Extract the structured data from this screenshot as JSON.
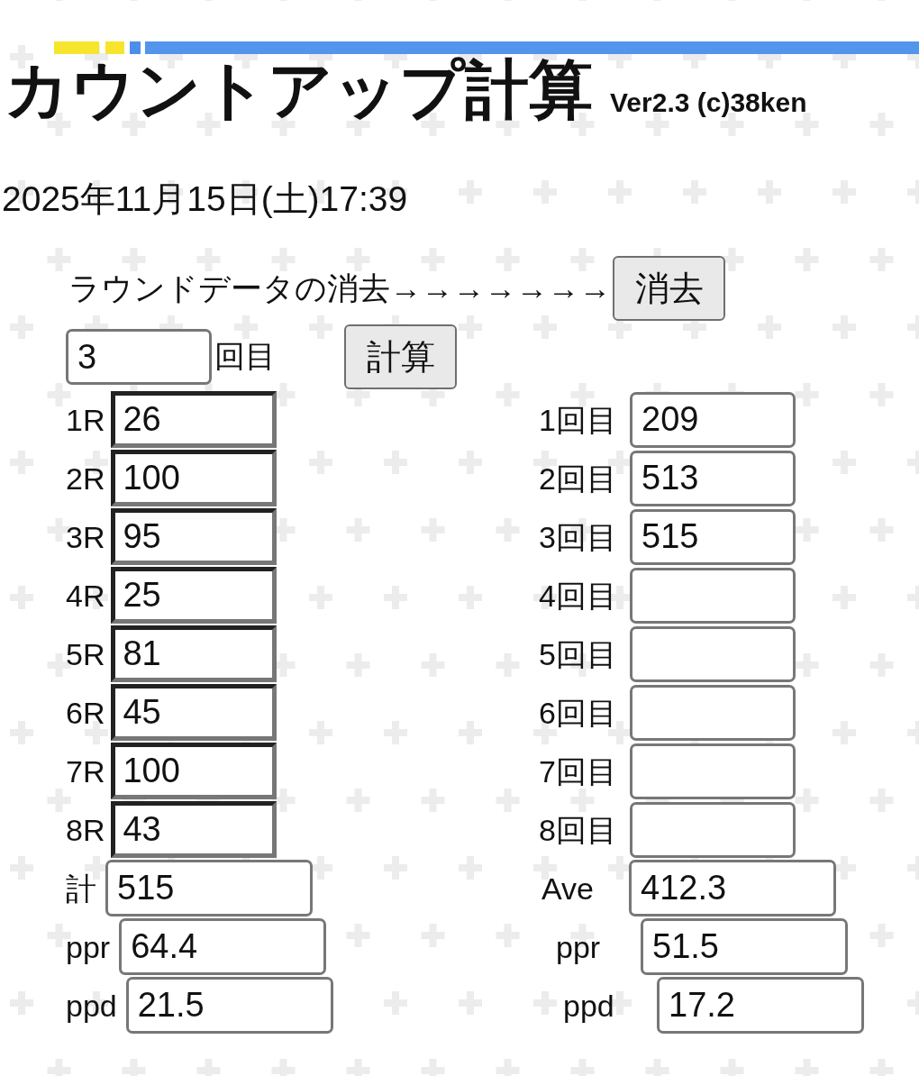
{
  "header": {
    "title": "カウントアップ計算",
    "version": "Ver2.3 (c)38ken"
  },
  "datetime": "2025年11月15日(土)17:39",
  "clear_row": {
    "label": "ラウンドデータの消去→→→→→→→",
    "button": "消去"
  },
  "game_select": {
    "value": "3",
    "suffix": "回目",
    "button": "計算"
  },
  "rounds": [
    {
      "label": "1R",
      "value": "26"
    },
    {
      "label": "2R",
      "value": "100"
    },
    {
      "label": "3R",
      "value": "95"
    },
    {
      "label": "4R",
      "value": "25"
    },
    {
      "label": "5R",
      "value": "81"
    },
    {
      "label": "6R",
      "value": "45"
    },
    {
      "label": "7R",
      "value": "100"
    },
    {
      "label": "8R",
      "value": "43"
    }
  ],
  "games": [
    {
      "label": "1回目",
      "value": "209"
    },
    {
      "label": "2回目",
      "value": "513"
    },
    {
      "label": "3回目",
      "value": "515"
    },
    {
      "label": "4回目"
    },
    {
      "label": "5回目"
    },
    {
      "label": "6回目"
    },
    {
      "label": "7回目"
    },
    {
      "label": "8回目"
    }
  ],
  "round_stats": [
    {
      "label": "計",
      "value": "515"
    },
    {
      "label": "ppr",
      "value": "64.4"
    },
    {
      "label": "ppd",
      "value": "21.5"
    }
  ],
  "game_stats": [
    {
      "label": "Ave",
      "value": "412.3"
    },
    {
      "label": "ppr",
      "value": "51.5"
    },
    {
      "label": "ppd",
      "value": "17.2"
    }
  ]
}
